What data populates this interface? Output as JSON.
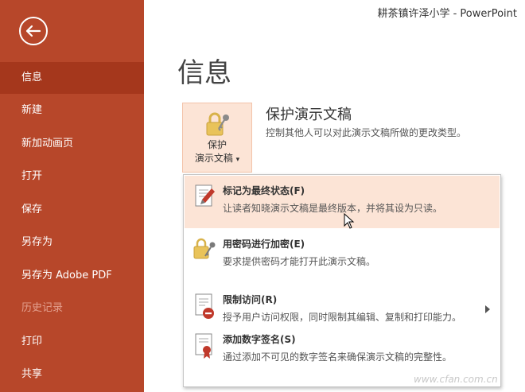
{
  "window": {
    "title": "耕茶镇许泽小学 - PowerPoint"
  },
  "sidebar": {
    "items": [
      {
        "label": "信息"
      },
      {
        "label": "新建"
      },
      {
        "label": "新加动画页"
      },
      {
        "label": "打开"
      },
      {
        "label": "保存"
      },
      {
        "label": "另存为"
      },
      {
        "label": "另存为 Adobe PDF"
      },
      {
        "label": "历史记录"
      },
      {
        "label": "打印"
      },
      {
        "label": "共享"
      }
    ],
    "active": "信息"
  },
  "main": {
    "title": "信息",
    "protect_button": {
      "line1": "保护",
      "line2": "演示文稿",
      "arrow": "▾"
    },
    "section_title": "保护演示文稿",
    "section_desc": "控制其他人可以对此演示文稿所做的更改类型。"
  },
  "dropdown": {
    "items": [
      {
        "title": "标记为最终状态(F)",
        "desc": "让读者知晓演示文稿是最终版本，并将其设为只读。",
        "icon": "mark-final-icon"
      },
      {
        "title": "用密码进行加密(E)",
        "desc": "要求提供密码才能打开此演示文稿。",
        "icon": "lock-key-icon"
      },
      {
        "title": "限制访问(R)",
        "desc": "授予用户访问权限，同时限制其编辑、复制和打印能力。",
        "icon": "restrict-access-icon",
        "has_submenu": true
      },
      {
        "title": "添加数字签名(S)",
        "desc": "通过添加不可见的数字签名来确保演示文稿的完整性。",
        "icon": "digital-signature-icon"
      }
    ]
  },
  "watermark": "www.cfan.com.cn",
  "colors": {
    "sidebar": "#b7472a",
    "sidebar_active": "#a5371c",
    "hover": "#fce4d6"
  }
}
